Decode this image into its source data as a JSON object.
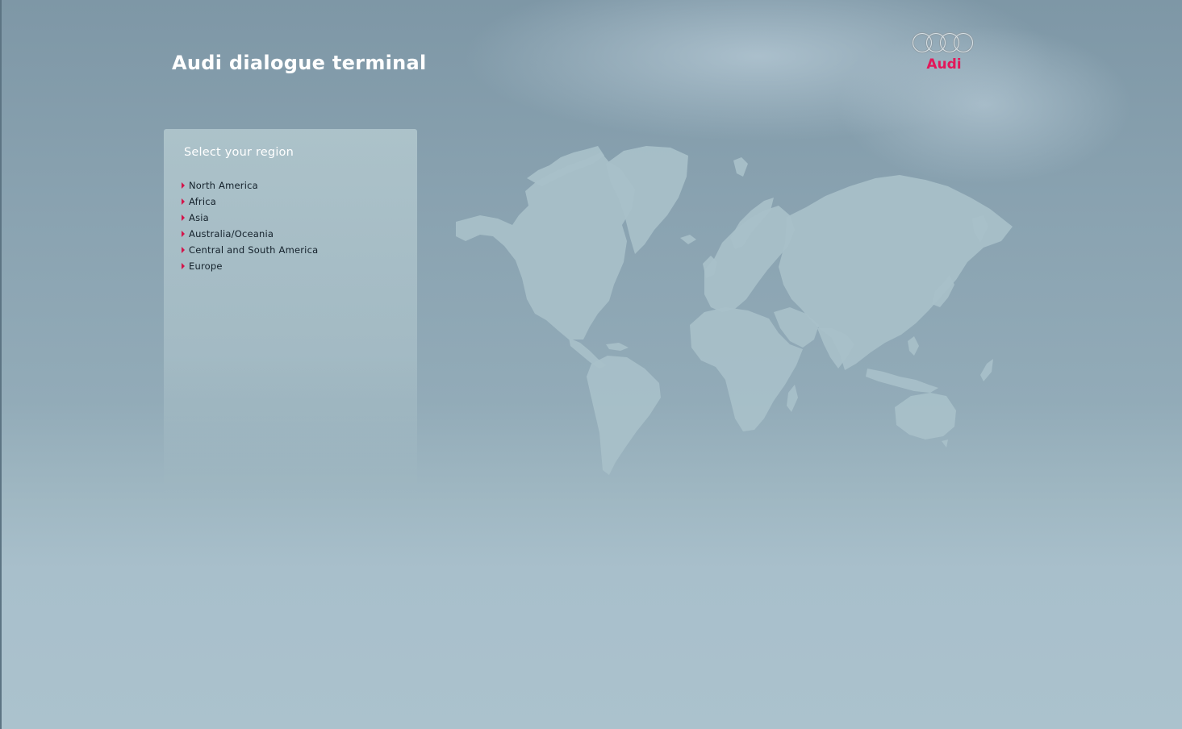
{
  "header": {
    "title": "Audi dialogue terminal"
  },
  "brand": {
    "logo_icon": "audi-rings-icon",
    "wordmark": "Audi",
    "wordmark_color": "#e2185a",
    "rings_color": "#8f9ea7"
  },
  "region_panel": {
    "heading": "Select your region",
    "bullet_icon": "arrow-right-icon",
    "bullet_color": "#d4134a",
    "items": [
      {
        "label": "North America"
      },
      {
        "label": "Africa"
      },
      {
        "label": "Asia"
      },
      {
        "label": "Australia/Oceania"
      },
      {
        "label": "Central and South America"
      },
      {
        "label": "Europe"
      }
    ]
  },
  "map": {
    "icon": "world-map-icon"
  },
  "colors": {
    "background": "#8aa3b1",
    "panel": "#aec4cb",
    "land": "#a8c0c9"
  }
}
